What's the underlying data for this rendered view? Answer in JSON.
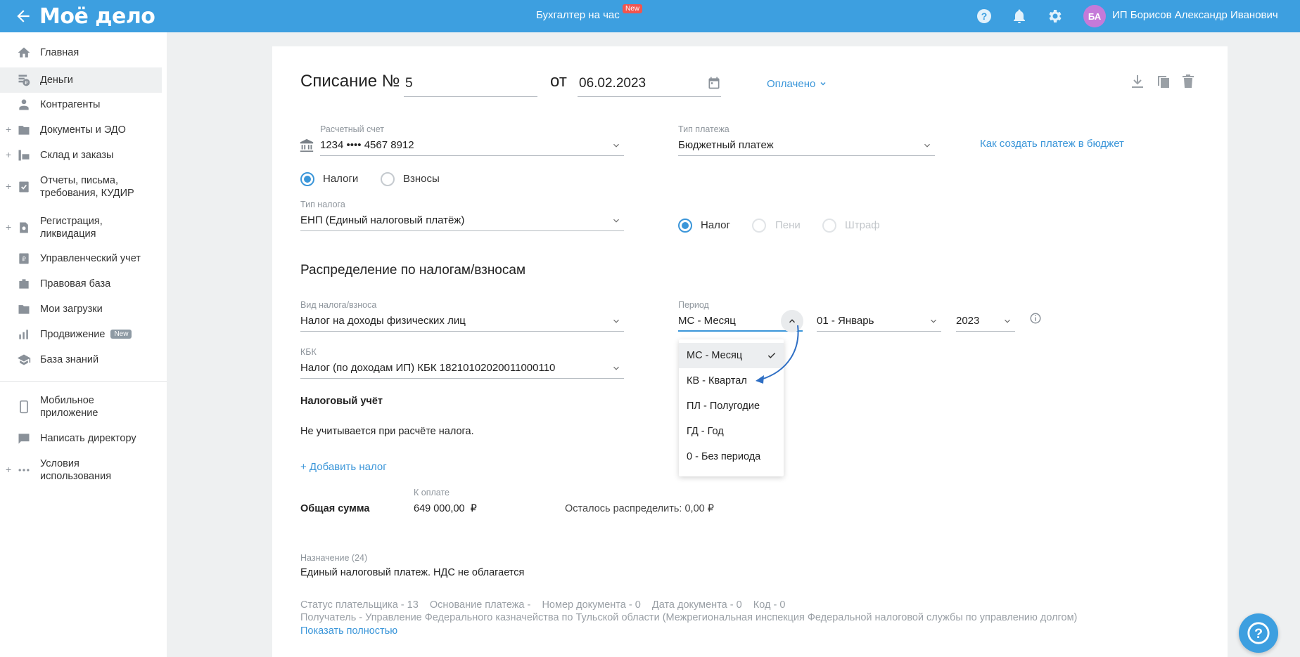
{
  "topbar": {
    "logo": "Моё дело",
    "center_link": "Бухгалтер на час",
    "new_badge": "New",
    "avatar_initials": "БА",
    "user_name": "ИП Борисов Александр Иванович"
  },
  "sidebar": {
    "items": [
      {
        "label": "Главная",
        "icon": "home-icon"
      },
      {
        "label": "Деньги",
        "icon": "money-icon"
      },
      {
        "label": "Контрагенты",
        "icon": "contractors-icon"
      },
      {
        "label": "Документы и ЭДО",
        "icon": "folder-icon"
      },
      {
        "label": "Склад и заказы",
        "icon": "warehouse-icon"
      },
      {
        "label": "Отчеты, письма, требования, КУДИР",
        "icon": "reports-icon"
      },
      {
        "label": "Регистрация, ликвидация",
        "icon": "registration-icon"
      },
      {
        "label": "Управленческий учет",
        "icon": "management-icon"
      },
      {
        "label": "Правовая база",
        "icon": "briefcase-icon"
      },
      {
        "label": "Мои загрузки",
        "icon": "downloads-icon"
      },
      {
        "label": "Продвижение",
        "icon": "promotion-icon",
        "badge": "New"
      },
      {
        "label": "База знаний",
        "icon": "knowledge-icon"
      },
      {
        "label": "Мобильное приложение",
        "icon": "mobile-icon"
      },
      {
        "label": "Написать директору",
        "icon": "message-icon"
      },
      {
        "label": "Условия использования",
        "icon": "more-icon"
      }
    ],
    "plus_sign": "+"
  },
  "form": {
    "title": "Списание №",
    "number": "5",
    "from_label": "от",
    "date": "06.02.2023",
    "status": "Оплачено",
    "account_label": "Расчетный счет",
    "account_value": "1234 •••• 4567 8912",
    "payment_type_label": "Тип платежа",
    "payment_type_value": "Бюджетный платеж",
    "budget_help_link": "Как создать платеж в бюджет",
    "radio_taxes": "Налоги",
    "radio_contributions": "Взносы",
    "tax_type_label": "Тип налога",
    "tax_type_value": "ЕНП (Единый налоговый платёж)",
    "radio_tax": "Налог",
    "radio_penalty": "Пени",
    "radio_fine": "Штраф",
    "section_title": "Распределение по налогам/взносам",
    "kind_label": "Вид налога/взноса",
    "kind_value": "Налог на доходы физических лиц",
    "period_label": "Период",
    "period_value": "МС - Месяц",
    "month_value": "01 - Январь",
    "year_value": "2023",
    "kbk_label": "КБК",
    "kbk_value": "Налог (по доходам ИП) КБК 18210102020011000110",
    "tax_accounting_title": "Налоговый учёт",
    "tax_accounting_text": "Не учитывается при расчёте налога.",
    "add_tax_link": "+ Добавить налог",
    "to_pay_label": "К оплате",
    "total_label": "Общая сумма",
    "total_value": "649 000,00",
    "currency": "₽",
    "remaining": "Осталось распределить: 0,00 ₽",
    "purpose_label": "Назначение (24)",
    "purpose_value": "Единый налоговый платеж. НДС не облагается",
    "details_line1": "Статус плательщика - 13    Основание платежа -    Номер документа - 0    Дата документа - 0    Код - 0",
    "details_line2": "Получатель - Управление Федерального казначейства по Тульской области (Межрегиональная инспекция Федеральной налоговой службы по управлению долгом)",
    "show_full_link": "Показать полностью"
  },
  "dropdown": {
    "options": [
      "МС - Месяц",
      "КВ - Квартал",
      "ПЛ - Полугодие",
      "ГД - Год",
      "0 - Без периода"
    ],
    "selected": "МС - Месяц"
  },
  "colors": {
    "brand": "#3d9fe0",
    "link": "#3b96d9",
    "badge_red": "#f2554f",
    "avatar": "#c57ad9"
  }
}
